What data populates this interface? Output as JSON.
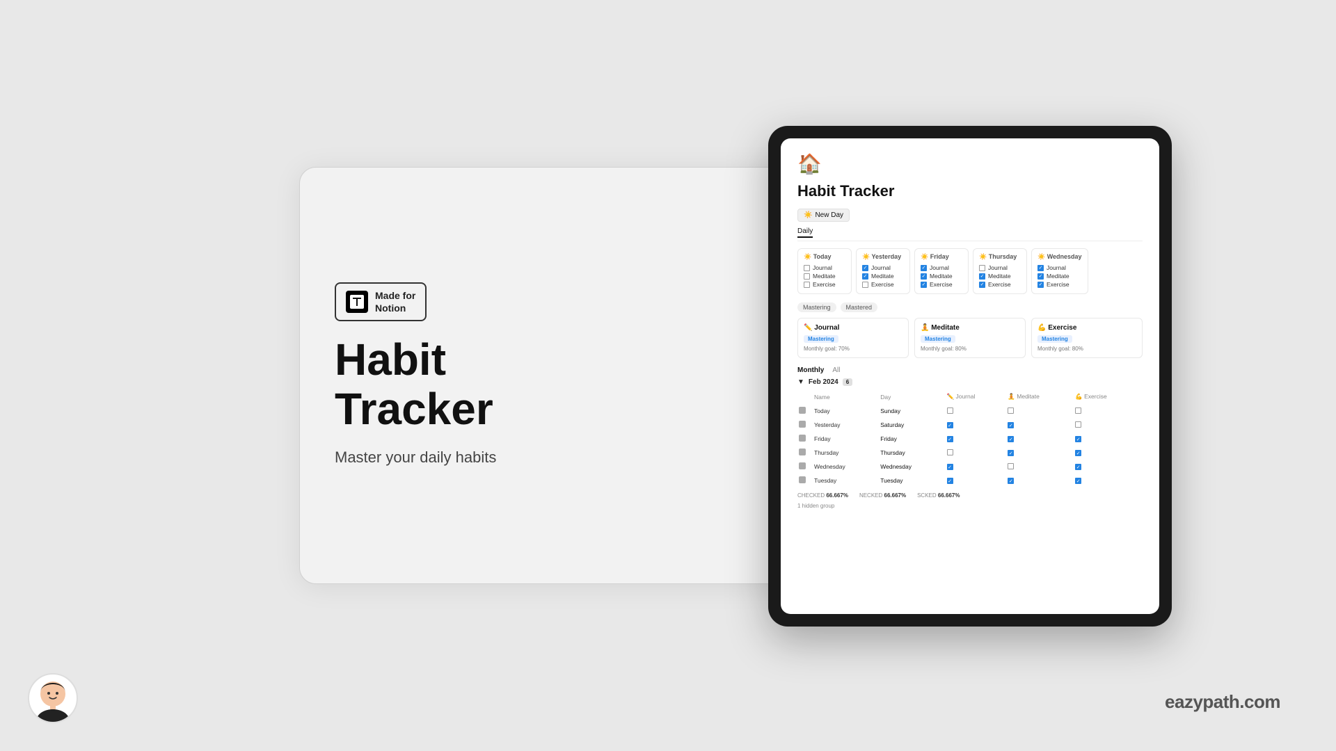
{
  "background_color": "#e8e8e8",
  "badge": {
    "made_for": "Made for",
    "notion": "Notion"
  },
  "app": {
    "title_line1": "Habit",
    "title_line2": "Tracker",
    "subtitle": "Master your daily habits"
  },
  "notion_page": {
    "title": "Habit Tracker",
    "new_day_button": "New Day",
    "daily_tab": "Daily",
    "monthly_tab": "Monthly",
    "all_tab": "All",
    "mastering_tab1": "Mastering",
    "mastering_tab2": "Mastered",
    "days": [
      {
        "label": "Today",
        "items": [
          "Journal",
          "Meditate",
          "Exercise"
        ],
        "checked": [
          false,
          false,
          false
        ]
      },
      {
        "label": "Yesterday",
        "items": [
          "Journal",
          "Meditate",
          "Exercise"
        ],
        "checked": [
          true,
          true,
          false
        ]
      },
      {
        "label": "Friday",
        "items": [
          "Journal",
          "Meditate",
          "Exercise"
        ],
        "checked": [
          true,
          true,
          true
        ]
      },
      {
        "label": "Thursday",
        "items": [
          "Journal",
          "Meditate",
          "Exercise"
        ],
        "checked": [
          false,
          true,
          true
        ]
      },
      {
        "label": "Wednesday",
        "items": [
          "Journal",
          "Meditate",
          "Exercise"
        ],
        "checked": [
          true,
          true,
          true
        ]
      }
    ],
    "mastering_cards": [
      {
        "icon": "✏️",
        "title": "Journal",
        "badge": "Mastering",
        "goal": "Monthly goal: 70%"
      },
      {
        "icon": "🧘",
        "title": "Meditate",
        "badge": "Mastering",
        "goal": "Monthly goal: 80%"
      },
      {
        "icon": "💪",
        "title": "Exercise",
        "badge": "Mastering",
        "goal": "Monthly goal: 80%"
      }
    ],
    "monthly_period": "Feb 2024",
    "monthly_count": "6",
    "monthly_columns": [
      "Name",
      "Day",
      "Journal",
      "Meditate",
      "Exercise"
    ],
    "monthly_rows": [
      {
        "name": "Today",
        "day": "Sunday",
        "journal": false,
        "meditate": false,
        "exercise": false
      },
      {
        "name": "Yesterday",
        "day": "Saturday",
        "journal": true,
        "meditate": true,
        "exercise": false
      },
      {
        "name": "Friday",
        "day": "Friday",
        "journal": true,
        "meditate": true,
        "exercise": true
      },
      {
        "name": "Thursday",
        "day": "Thursday",
        "journal": false,
        "meditate": true,
        "exercise": true
      },
      {
        "name": "Wednesday",
        "day": "Wednesday",
        "journal": true,
        "meditate": false,
        "exercise": true
      },
      {
        "name": "Tuesday",
        "day": "Tuesday",
        "journal": true,
        "meditate": true,
        "exercise": true
      }
    ],
    "stats": {
      "checked_label": "CHECKED",
      "checked_value": "66.667%",
      "necked_label": "NECKED",
      "necked_value": "66.667%",
      "scked_label": "SCKED",
      "scked_value": "66.667%"
    },
    "hidden_group": "1 hidden group"
  },
  "website": "eazypath.com"
}
